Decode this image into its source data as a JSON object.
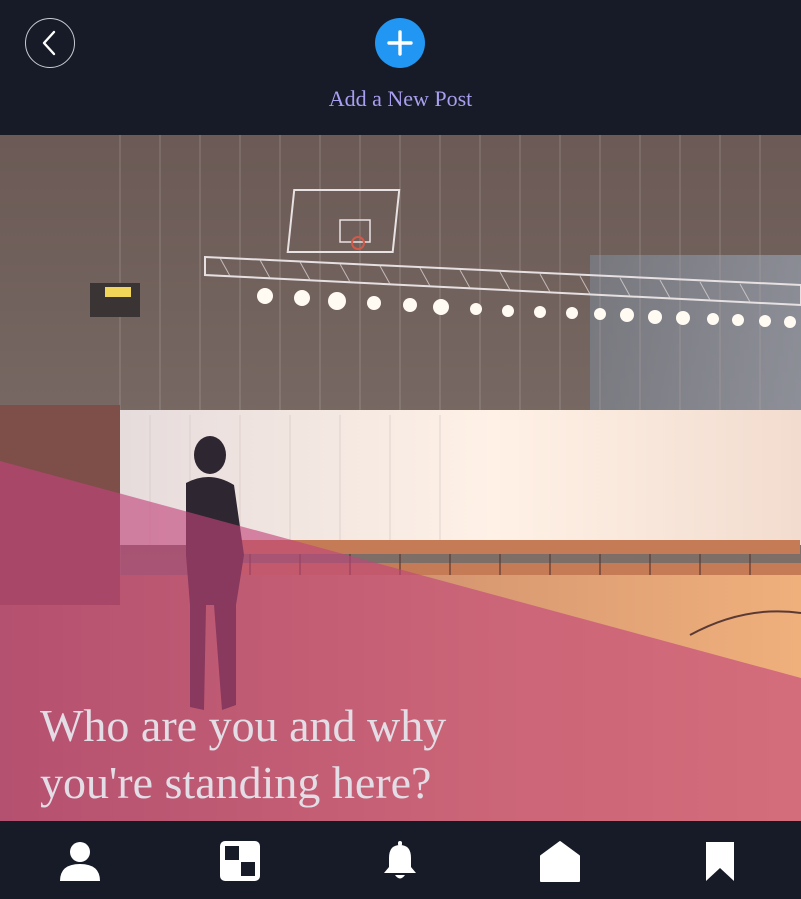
{
  "header": {
    "add_post_label": "Add a New Post",
    "back_icon": "chevron-left-icon",
    "add_icon": "plus-icon",
    "accent_color": "#2196f3",
    "label_color": "#a99ff0"
  },
  "post": {
    "caption_line1": "Who are you and why",
    "caption_line2": "you're standing here?",
    "overlay_color": "#c2437a"
  },
  "tabbar": {
    "items": [
      {
        "icon": "user-icon"
      },
      {
        "icon": "board-icon"
      },
      {
        "icon": "bell-icon"
      },
      {
        "icon": "home-icon"
      },
      {
        "icon": "bookmark-icon"
      }
    ]
  }
}
